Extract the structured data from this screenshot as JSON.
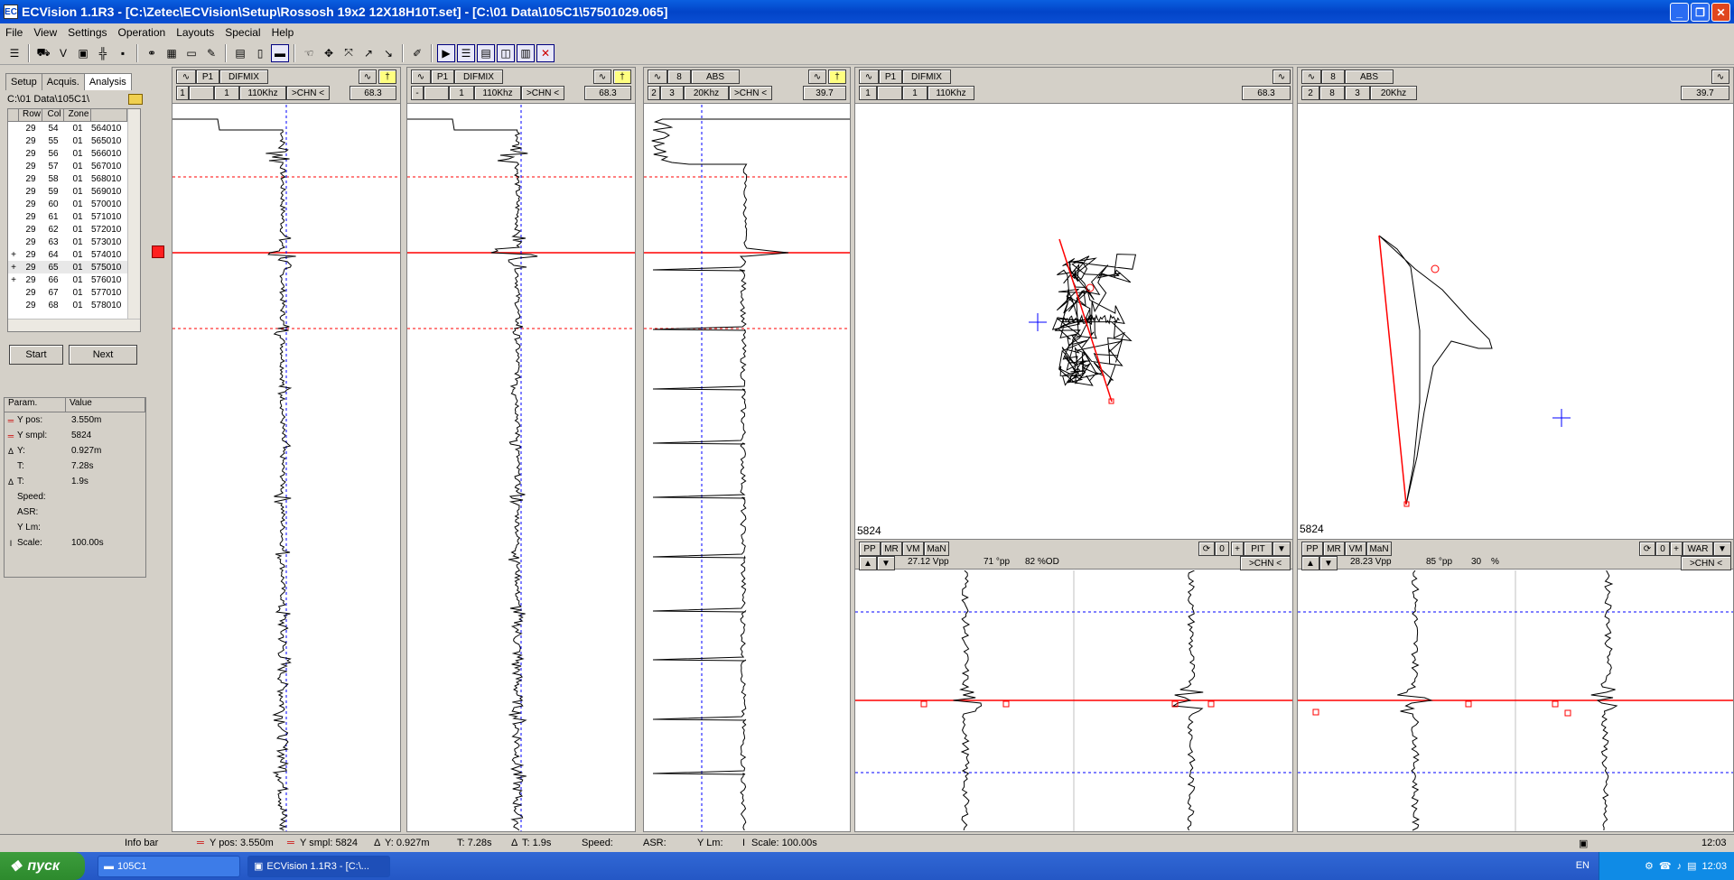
{
  "window": {
    "title": "ECVision 1.1R3 - [C:\\Zetec\\ECVision\\Setup\\Rossosh 19x2 12X18H10T.set] - [C:\\01 Data\\105C1\\57501029.065]"
  },
  "menu": [
    "File",
    "View",
    "Settings",
    "Operation",
    "Layouts",
    "Special",
    "Help"
  ],
  "left_tabs": [
    "Setup",
    "Acquis.",
    "Analysis"
  ],
  "data_path": "C:\\01 Data\\105C1\\",
  "row_table": {
    "headers": [
      "Row",
      "Col",
      "Zone",
      ""
    ],
    "rows": [
      {
        "mark": "",
        "row": "29",
        "col": "54",
        "zone": "01",
        "file": "564010"
      },
      {
        "mark": "",
        "row": "29",
        "col": "55",
        "zone": "01",
        "file": "565010"
      },
      {
        "mark": "",
        "row": "29",
        "col": "56",
        "zone": "01",
        "file": "566010"
      },
      {
        "mark": "",
        "row": "29",
        "col": "57",
        "zone": "01",
        "file": "567010"
      },
      {
        "mark": "",
        "row": "29",
        "col": "58",
        "zone": "01",
        "file": "568010"
      },
      {
        "mark": "",
        "row": "29",
        "col": "59",
        "zone": "01",
        "file": "569010"
      },
      {
        "mark": "",
        "row": "29",
        "col": "60",
        "zone": "01",
        "file": "570010"
      },
      {
        "mark": "",
        "row": "29",
        "col": "61",
        "zone": "01",
        "file": "571010"
      },
      {
        "mark": "",
        "row": "29",
        "col": "62",
        "zone": "01",
        "file": "572010"
      },
      {
        "mark": "",
        "row": "29",
        "col": "63",
        "zone": "01",
        "file": "573010"
      },
      {
        "mark": "+",
        "row": "29",
        "col": "64",
        "zone": "01",
        "file": "574010"
      },
      {
        "mark": "+",
        "row": "29",
        "col": "65",
        "zone": "01",
        "file": "575010"
      },
      {
        "mark": "+",
        "row": "29",
        "col": "66",
        "zone": "01",
        "file": "576010"
      },
      {
        "mark": "",
        "row": "29",
        "col": "67",
        "zone": "01",
        "file": "577010"
      },
      {
        "mark": "",
        "row": "29",
        "col": "68",
        "zone": "01",
        "file": "578010"
      }
    ]
  },
  "buttons": {
    "start": "Start",
    "next": "Next"
  },
  "params": {
    "headers": [
      "Param.",
      "Value"
    ],
    "rows": [
      {
        "icon": "red-lines",
        "name": "Y pos:",
        "value": "3.550m"
      },
      {
        "icon": "red-lines",
        "name": "Y smpl:",
        "value": "5824"
      },
      {
        "icon": "delta",
        "name": "Y:",
        "value": "0.927m"
      },
      {
        "icon": "",
        "name": "T:",
        "value": "7.28s"
      },
      {
        "icon": "delta",
        "name": "T:",
        "value": "1.9s"
      },
      {
        "icon": "",
        "name": "Speed:",
        "value": ""
      },
      {
        "icon": "",
        "name": "ASR:",
        "value": ""
      },
      {
        "icon": "",
        "name": "Y Lm:",
        "value": ""
      },
      {
        "icon": "scale",
        "name": "Scale:",
        "value": "100.00s"
      }
    ]
  },
  "strip1": {
    "ch": "1",
    "probe": "P1",
    "mode": "DIFMIX",
    "b1": "",
    "b2": "1",
    "freq": "110Khz",
    "chn": ">CHN <",
    "value": "68.3"
  },
  "strip2": {
    "ch": "-",
    "probe": "P1",
    "mode": "DIFMIX",
    "b1": "",
    "b2": "1",
    "freq": "110Khz",
    "chn": ">CHN <",
    "value": "68.3"
  },
  "strip3": {
    "ch": "2",
    "probe": "8",
    "mode": "ABS",
    "b1": "3",
    "freq": "20Khz",
    "chn": ">CHN <",
    "value": "39.7"
  },
  "lissa1": {
    "ch": "1",
    "probe": "P1",
    "mode": "DIFMIX",
    "b1": "",
    "b2": "1",
    "freq": "110Khz",
    "value": "68.3",
    "sample": "5824",
    "btns": [
      "PP",
      "MR",
      "VM",
      "MaN"
    ],
    "vpp": "27.12 Vpp",
    "deg": "71 °pp",
    "pct": "82 %OD",
    "counter": "0",
    "flaw": "PIT",
    "chn": ">CHN <"
  },
  "lissa2": {
    "ch": "2",
    "probe": "8",
    "mode": "ABS",
    "b1": "8",
    "b2": "3",
    "freq": "20Khz",
    "value": "39.7",
    "sample": "5824",
    "btns": [
      "PP",
      "MR",
      "VM",
      "MaN"
    ],
    "vpp": "28.23 Vpp",
    "deg": "85 °pp",
    "pct": "30",
    "pctunit": "%",
    "counter": "0",
    "flaw": "WAR",
    "chn": ">CHN <"
  },
  "statusbar": {
    "info": "Info bar",
    "ypos": "Y pos: 3.550m",
    "ysmpl": "Y smpl: 5824",
    "dy": "Y: 0.927m",
    "t": "T: 7.28s",
    "dt": "T: 1.9s",
    "speed": "Speed:",
    "asr": "ASR:",
    "ylm": "Y Lm:",
    "scale": "Scale: 100.00s",
    "clock": "12:03"
  },
  "taskbar": {
    "start": "пуск",
    "tasks": [
      "105C1",
      "ECVision 1.1R3 - [C:\\..."
    ],
    "lang": "EN",
    "clock": "12:03"
  },
  "colors": {
    "titlebar": "#0244c8",
    "trace": "#000000",
    "cursor": "#ff0000",
    "guide": "#0000ff"
  }
}
